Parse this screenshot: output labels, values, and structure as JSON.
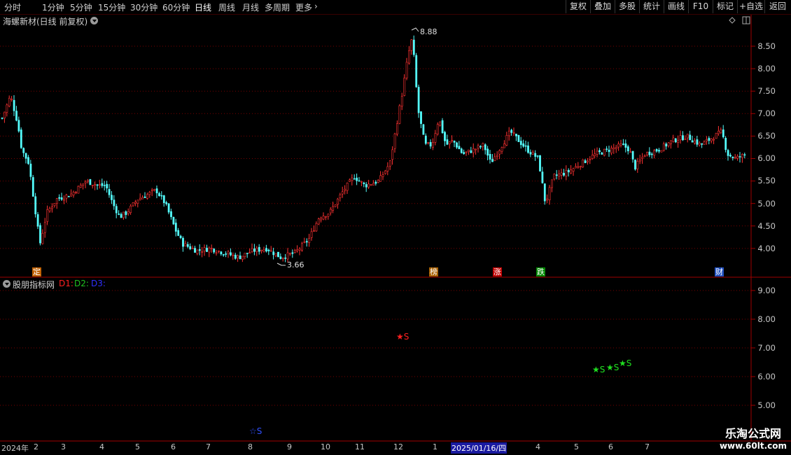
{
  "toolbar": {
    "periods": [
      "分时",
      "1分钟",
      "5分钟",
      "15分钟",
      "30分钟",
      "60分钟",
      "日线",
      "周线",
      "月线",
      "多周期",
      "更多"
    ],
    "active_period": "日线",
    "more_arrow": "›",
    "buttons": [
      "复权",
      "叠加",
      "多股",
      "统计",
      "画线",
      "F10",
      "标记",
      "+自选",
      "返回"
    ]
  },
  "main_panel": {
    "title": "海螺新材(日线 前复权)",
    "y_ticks": [
      "8.50",
      "8.00",
      "7.50",
      "7.00",
      "6.50",
      "6.00",
      "5.50",
      "5.00",
      "4.50",
      "4.00"
    ],
    "high_label": "8.88",
    "low_label": "3.66",
    "event_tags": [
      {
        "text": "定",
        "color": "#c06000"
      },
      {
        "text": "榜",
        "color": "#a86000"
      },
      {
        "text": "涨",
        "color": "#c00000"
      },
      {
        "text": "跌",
        "color": "#008800"
      },
      {
        "text": "财",
        "color": "#2050c0"
      }
    ]
  },
  "indicator_panel": {
    "title": "股朋指标网",
    "series": [
      {
        "name": "D1:",
        "color": "#ff2020"
      },
      {
        "name": "D2:",
        "color": "#20c020"
      },
      {
        "name": "D3:",
        "color": "#3030ff"
      }
    ],
    "y_ticks": [
      "9.00",
      "8.00",
      "7.00",
      "6.00",
      "5.00"
    ],
    "signals": [
      {
        "label": "★S",
        "color": "#ff2020"
      },
      {
        "label": "★S",
        "color": "#20e020"
      },
      {
        "label": "★S",
        "color": "#20e020"
      },
      {
        "label": "★S",
        "color": "#20e020"
      },
      {
        "label": "☆S",
        "color": "#3050ff"
      }
    ]
  },
  "x_axis": {
    "labels": [
      "2024年",
      "2",
      "3",
      "4",
      "5",
      "6",
      "7",
      "8",
      "9",
      "10",
      "11",
      "12",
      "1",
      "2025/01/16/四",
      "4",
      "5",
      "6",
      "7"
    ]
  },
  "watermark": {
    "line1": "乐淘公式网",
    "line2": "www.60lt.com"
  },
  "colors": {
    "up": "#ff3232",
    "down": "#54fcfc",
    "grid": "#7a0000",
    "axis": "#a00000"
  }
}
